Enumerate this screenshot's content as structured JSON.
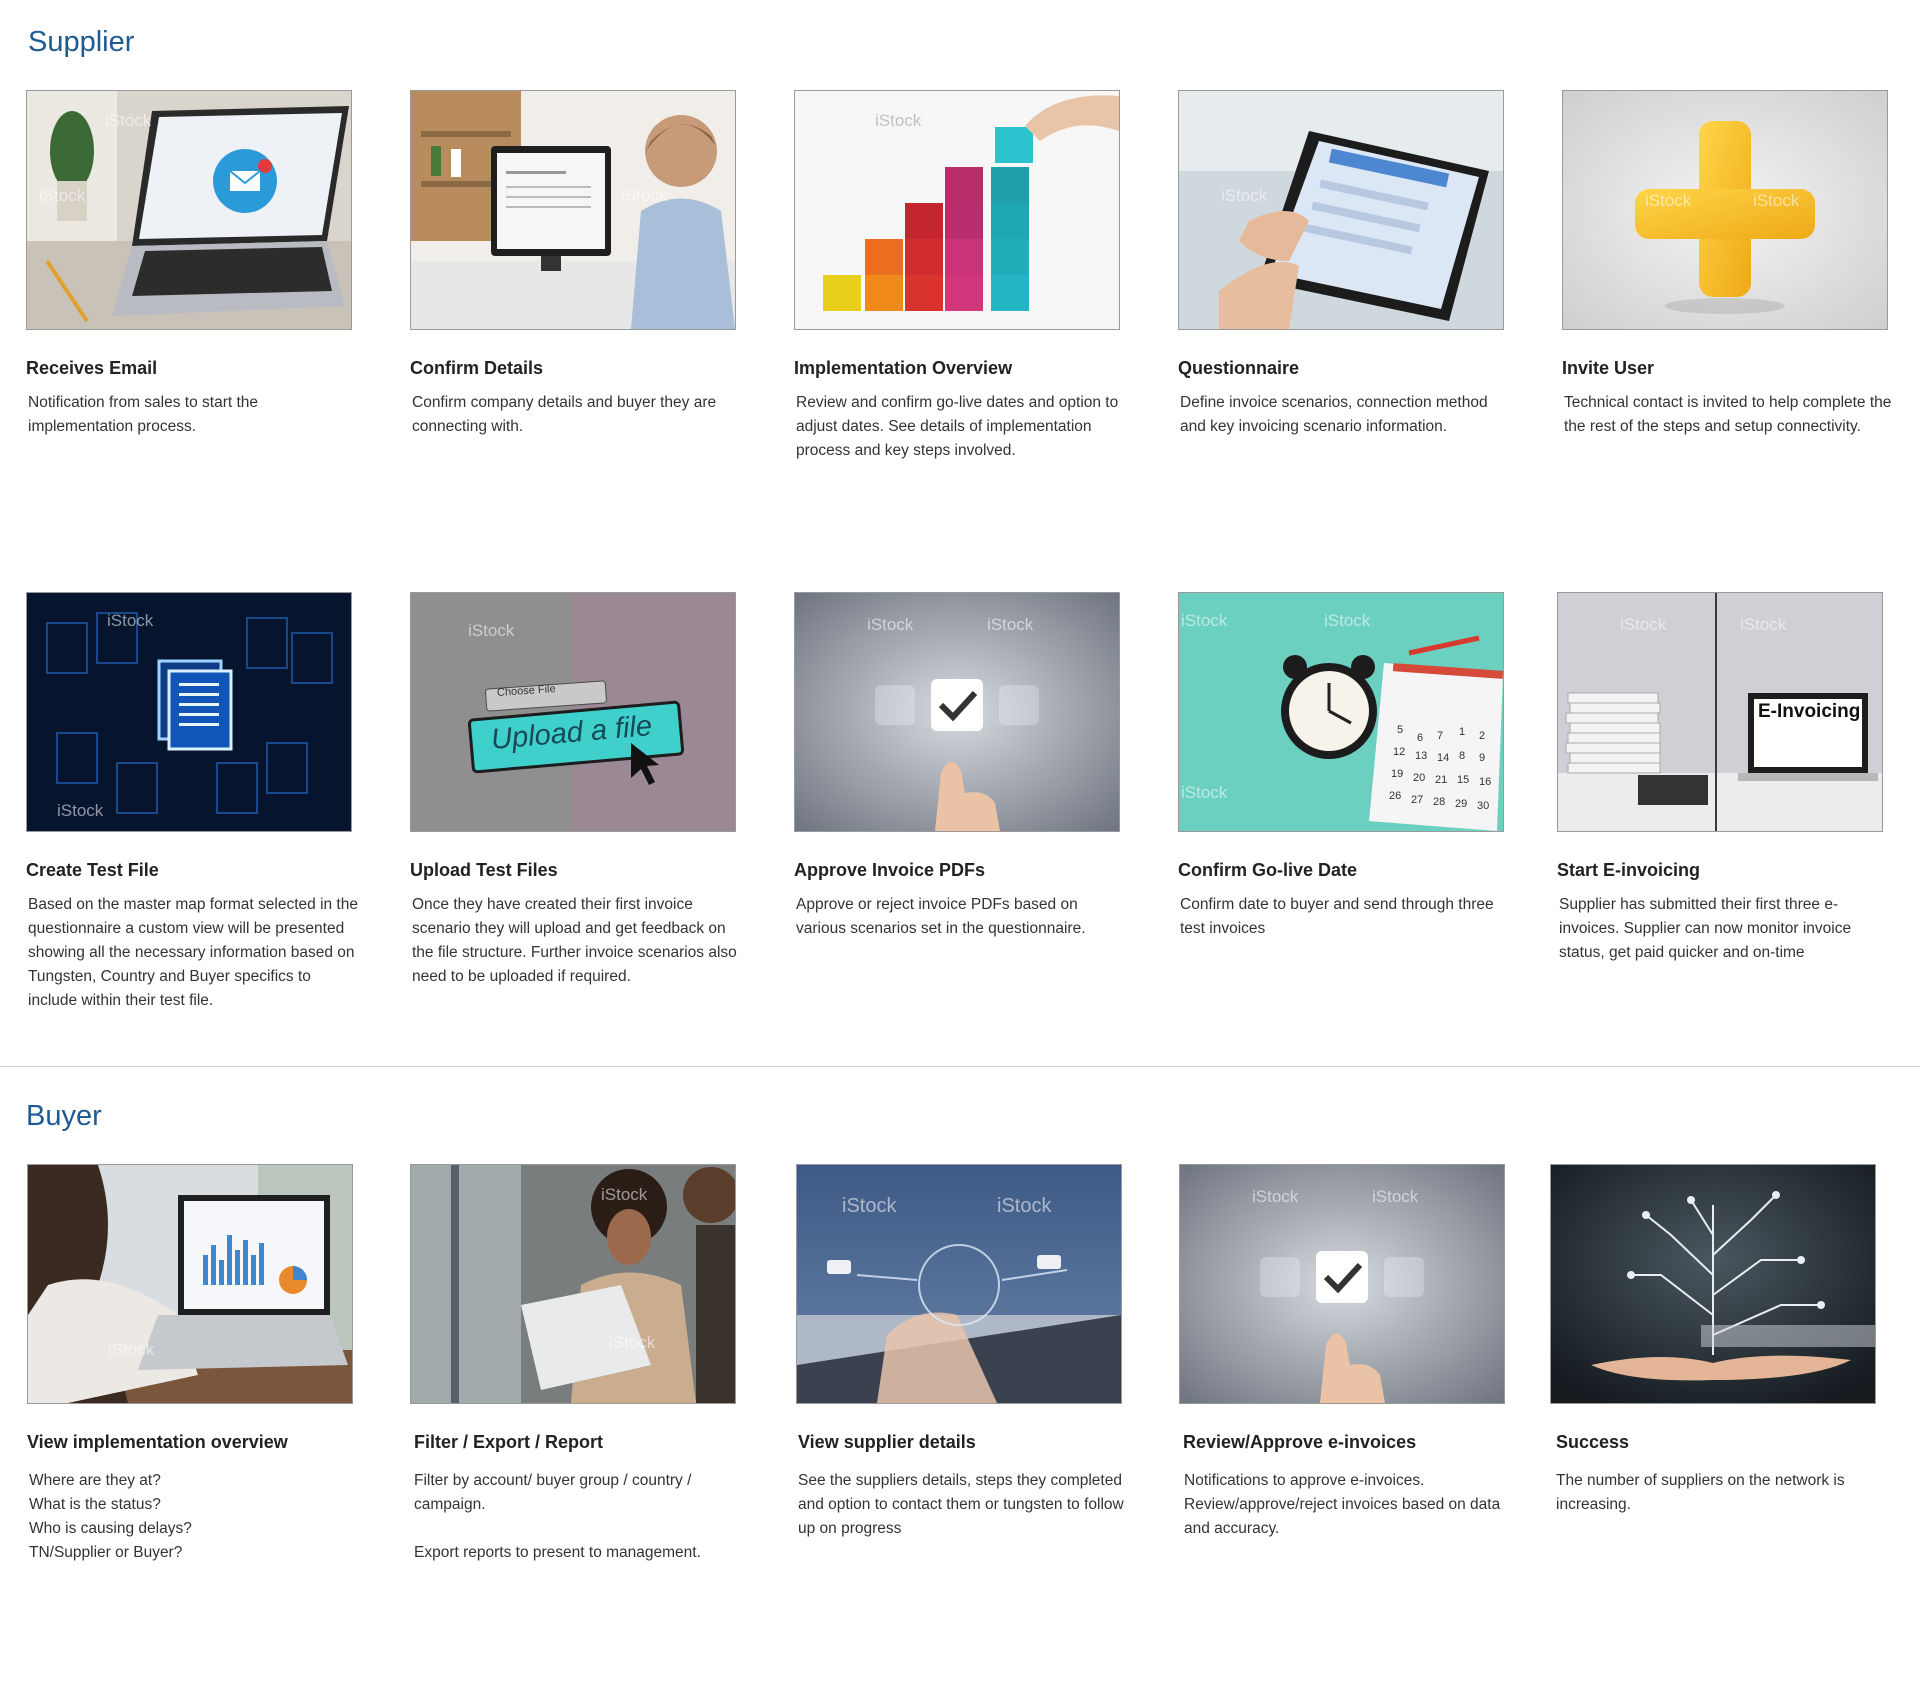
{
  "supplier": {
    "title": "Supplier",
    "cards": [
      {
        "title": "Receives Email",
        "desc": "Notification from sales to start the implementation process.",
        "icon": "laptop-email-image"
      },
      {
        "title": "Confirm Details",
        "desc": "Confirm company details and buyer they are connecting with.",
        "icon": "desk-monitor-image"
      },
      {
        "title": "Implementation Overview",
        "desc": "Review and confirm go-live dates and option to adjust dates. See details of implementation process and key steps involved.",
        "icon": "blocks-steps-image"
      },
      {
        "title": "Questionnaire",
        "desc": "Define invoice scenarios, connection method and key invoicing scenario information.",
        "icon": "tablet-survey-image"
      },
      {
        "title": "Invite User",
        "desc": "Technical contact is invited to help complete the the rest of the steps and setup connectivity.",
        "icon": "plus-sign-image"
      },
      {
        "title": "Create Test File",
        "desc": "Based on the master map format selected in the questionnaire a custom view will be presented showing all the necessary information based on Tungsten, Country and Buyer specifics to include within their test file.",
        "icon": "digital-files-image"
      },
      {
        "title": "Upload Test Files",
        "desc": "Once they have created their first invoice scenario they will upload and get feedback on the file structure. Further invoice scenarios also need to be uploaded if required.",
        "icon": "upload-file-image"
      },
      {
        "title": "Approve Invoice PDFs",
        "desc": "Approve or reject invoice PDFs based on various scenarios set in the questionnaire.",
        "icon": "checkmark-touch-image"
      },
      {
        "title": "Confirm Go-live Date",
        "desc": "Confirm date to buyer and send through three test invoices",
        "icon": "clock-calendar-image"
      },
      {
        "title": "Start E-invoicing",
        "desc": "Supplier has submitted their first three e-invoices. Supplier can now monitor invoice status, get paid quicker and on-time",
        "icon": "e-invoicing-image"
      }
    ]
  },
  "buyer": {
    "title": "Buyer",
    "cards": [
      {
        "title": "View implementation overview",
        "lines": [
          "Where are they at?",
          "What is the status?",
          "Who is causing delays?",
          "TN/Supplier or Buyer?"
        ],
        "icon": "laptop-analytics-image"
      },
      {
        "title": "Filter / Export / Report",
        "lines": [
          "Filter by account/ buyer group / country / campaign.",
          "",
          "Export reports to present to management."
        ],
        "icon": "woman-laptop-image"
      },
      {
        "title": "View supplier details",
        "lines": [
          "See the suppliers details, steps they completed and option to contact them or tungsten to follow up on progress"
        ],
        "icon": "keyboard-network-image"
      },
      {
        "title": "Review/Approve e-invoices",
        "lines": [
          "Notifications to approve e-invoices. Review/approve/reject invoices based on data and accuracy."
        ],
        "icon": "checkmark-touch-image"
      },
      {
        "title": "Success",
        "lines": [
          "The number of suppliers on the network is increasing."
        ],
        "icon": "hand-circuit-tree-image"
      }
    ]
  },
  "watermark": "iStock",
  "upload_text": "Upload a file",
  "choose_file_text": "Choose File",
  "einvoicing_text": "E-Invoicing",
  "colors": {
    "accent": "#1f5a93",
    "divider": "#cfcfcf"
  }
}
